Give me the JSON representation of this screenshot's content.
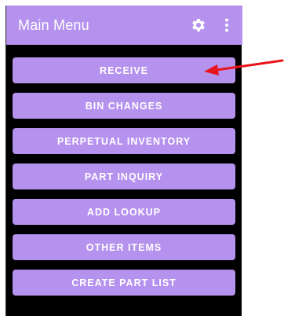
{
  "app": {
    "title": "Main Menu",
    "accent_color": "#b692ef",
    "background_color": "#000000"
  },
  "appbar": {
    "settings_icon": "gear-icon",
    "overflow_icon": "kebab-menu-icon"
  },
  "menu": {
    "items": [
      {
        "label": "RECEIVE"
      },
      {
        "label": "BIN CHANGES"
      },
      {
        "label": "PERPETUAL INVENTORY"
      },
      {
        "label": "PART INQUIRY"
      },
      {
        "label": "ADD LOOKUP"
      },
      {
        "label": "OTHER ITEMS"
      },
      {
        "label": "CREATE PART LIST"
      }
    ]
  },
  "annotation": {
    "arrow_color": "#e8141c",
    "points_to": "RECEIVE"
  }
}
